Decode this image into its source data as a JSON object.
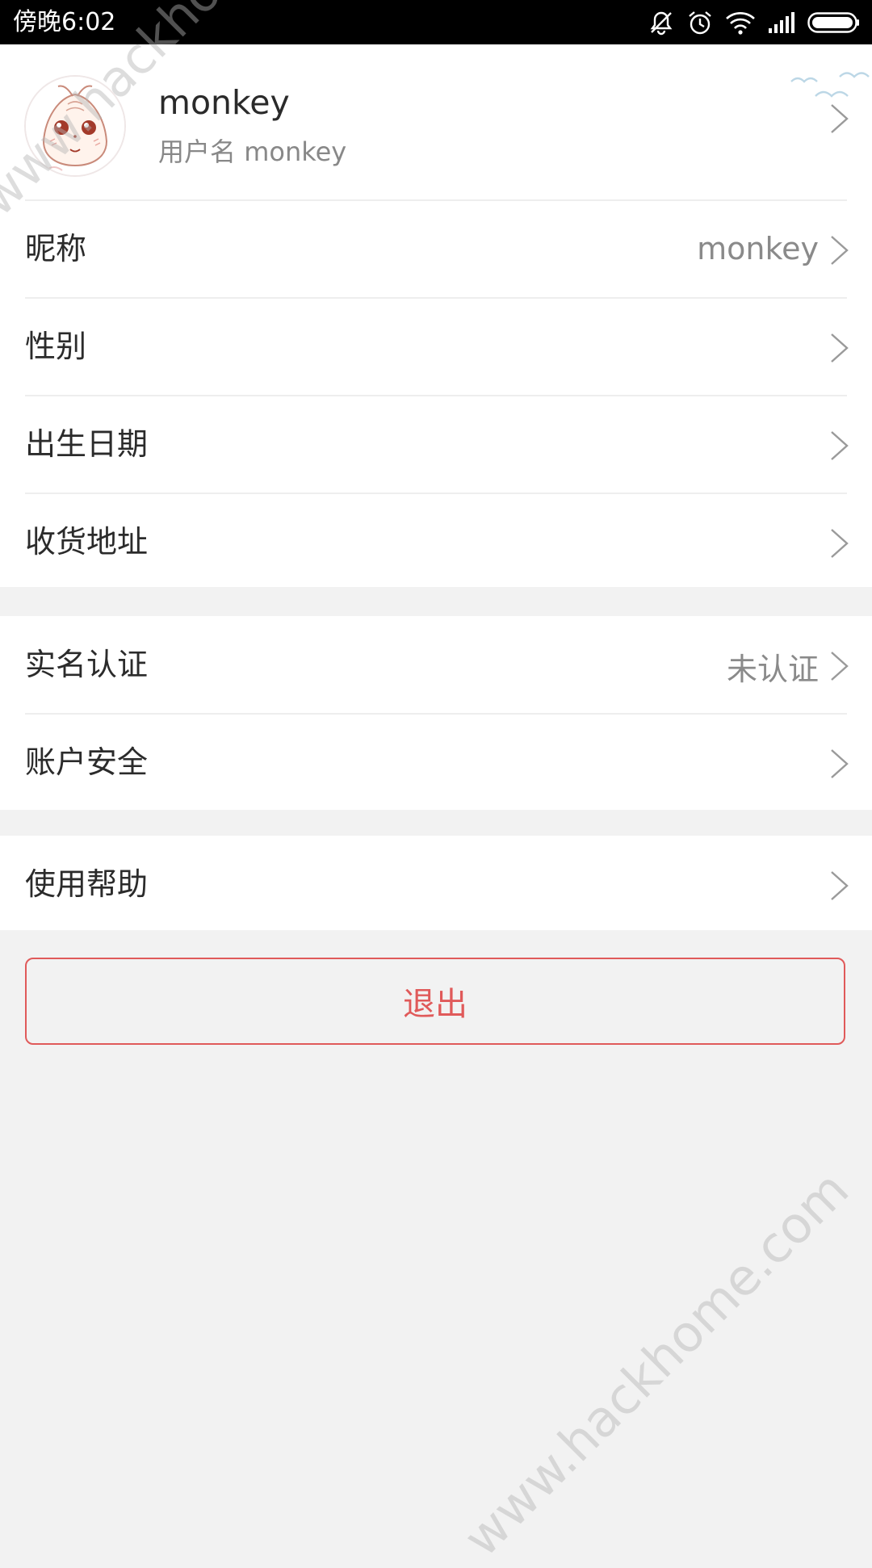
{
  "status_bar": {
    "time": "傍晚6:02",
    "icons": [
      "mute-icon",
      "alarm-icon",
      "wifi-icon",
      "signal-icon",
      "battery-icon"
    ]
  },
  "profile": {
    "name": "monkey",
    "username_label": "用户名",
    "username": "monkey"
  },
  "info_rows": [
    {
      "label": "昵称",
      "value": "monkey"
    },
    {
      "label": "性别",
      "value": ""
    },
    {
      "label": "出生日期",
      "value": ""
    },
    {
      "label": "收货地址",
      "value": ""
    }
  ],
  "security_rows": [
    {
      "label": "实名认证",
      "value": "未认证"
    },
    {
      "label": "账户安全",
      "value": ""
    }
  ],
  "help_rows": [
    {
      "label": "使用帮助",
      "value": ""
    }
  ],
  "logout_label": "退出",
  "watermark": "www.hackhome.com",
  "colors": {
    "accent": "#e05a5a",
    "background": "#f2f2f2",
    "card": "#ffffff",
    "text": "#2b2b2b",
    "muted": "#8a8a8a"
  }
}
